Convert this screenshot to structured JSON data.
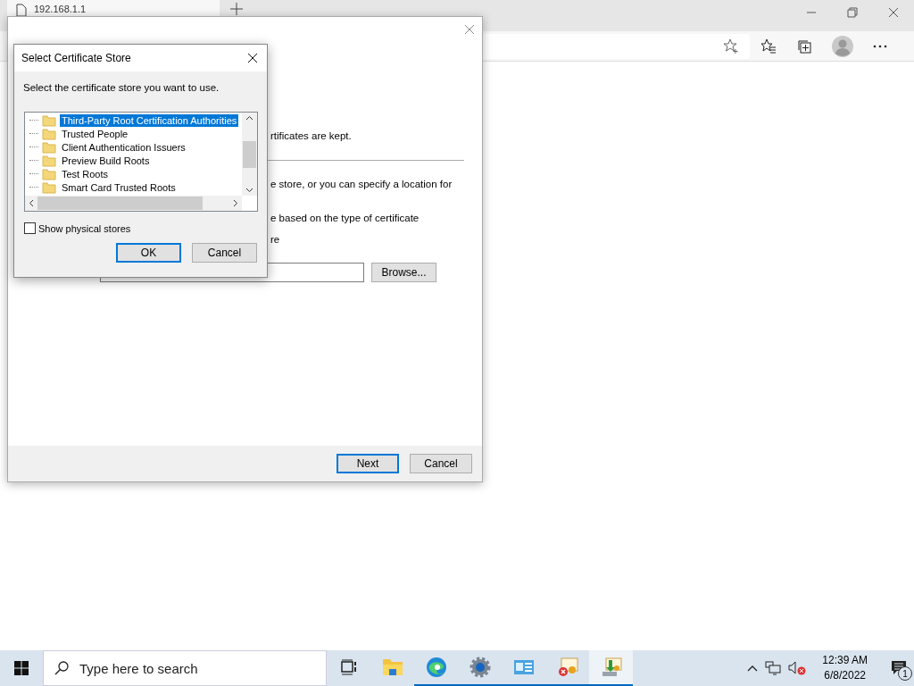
{
  "browser": {
    "tab": {
      "title": "192.168.1.1"
    }
  },
  "wizard": {
    "lines": [
      {
        "kind": "text",
        "text": "rtificates are kept."
      },
      {
        "kind": "rule"
      },
      {
        "kind": "text",
        "text": "e store, or you can specify a location for"
      },
      {
        "kind": "text",
        "text": "e based on the type of certificate"
      },
      {
        "kind": "text",
        "text": "re"
      }
    ],
    "browse_button": "Browse...",
    "buttons": [
      {
        "label": "Next",
        "default": true
      },
      {
        "label": "Cancel",
        "default": false
      }
    ]
  },
  "dialog": {
    "title": "Select Certificate Store",
    "prompt": "Select the certificate store you want to use.",
    "stores": [
      {
        "label": "Third-Party Root Certification Authorities",
        "selected": true
      },
      {
        "label": "Trusted People",
        "selected": false
      },
      {
        "label": "Client Authentication Issuers",
        "selected": false
      },
      {
        "label": "Preview Build Roots",
        "selected": false
      },
      {
        "label": "Test Roots",
        "selected": false
      },
      {
        "label": "Smart Card Trusted Roots",
        "selected": false
      }
    ],
    "show_physical_stores": {
      "label": "Show physical stores",
      "checked": false
    },
    "buttons": [
      {
        "label": "OK",
        "default": true
      },
      {
        "label": "Cancel",
        "default": false
      }
    ]
  },
  "taskbar": {
    "search_placeholder": "Type here to search",
    "apps": [
      {
        "kind": "task-view",
        "running": false,
        "active": false
      },
      {
        "kind": "folder",
        "running": false,
        "active": false
      },
      {
        "kind": "browser",
        "running": true,
        "active": false
      },
      {
        "kind": "gear",
        "running": true,
        "active": false
      },
      {
        "kind": "console",
        "running": true,
        "active": false
      },
      {
        "kind": "cert-error",
        "running": true,
        "active": false
      },
      {
        "kind": "cert-import",
        "running": true,
        "active": true
      }
    ],
    "time": "12:39 AM",
    "date": "6/8/2022",
    "notification_count": "1"
  }
}
